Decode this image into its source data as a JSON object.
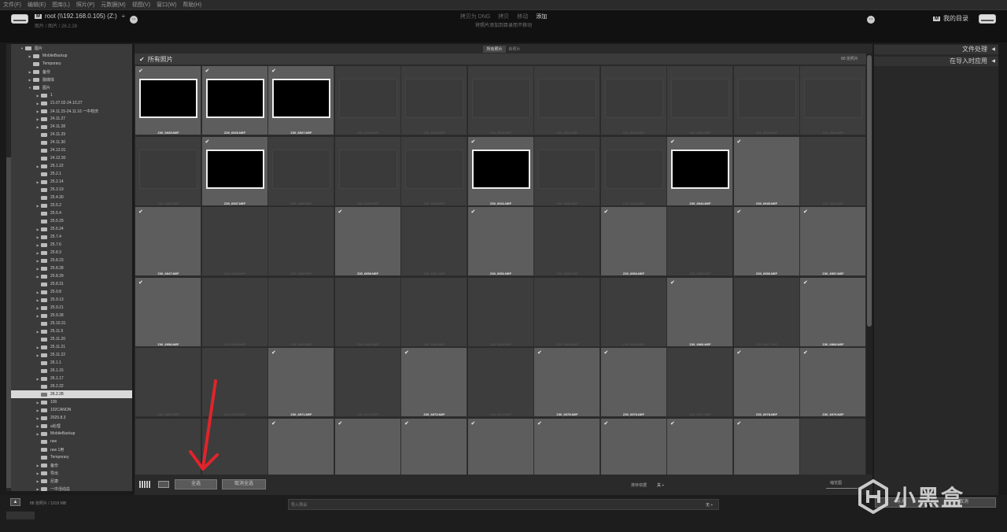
{
  "menu": [
    "文件(F)",
    "编辑(E)",
    "图库(L)",
    "照片(P)",
    "元数据(M)",
    "视图(V)",
    "窗口(W)",
    "帮助(H)"
  ],
  "header": {
    "source_badge": "M",
    "source_name": "root (\\\\192.168.0.105) (Z:)",
    "source_dropdown": "÷",
    "source_sub": "图片 / 图片 / 26.2.28",
    "left_nav": "⇔",
    "mode_tabs": [
      "拷贝为 DNG",
      "拷贝",
      "移动",
      "添加"
    ],
    "active_mode": "添加",
    "mode_desc": "将照片添加到目录而不移动",
    "right_nav": "⇔",
    "dest_badge": "M",
    "dest_name": "我的目录"
  },
  "view_tabs": [
    "所有照片",
    "新照片"
  ],
  "all_photos_label": "所有照片",
  "photo_count": "88 张照片",
  "folders": [
    {
      "label": "图片",
      "depth": 1,
      "tri": "▼"
    },
    {
      "label": "MobileBackup",
      "depth": 2,
      "tri": "▶"
    },
    {
      "label": "Temporary",
      "depth": 2,
      "tri": ""
    },
    {
      "label": "备份",
      "depth": 2,
      "tri": "▶"
    },
    {
      "label": "融媒体",
      "depth": 2,
      "tri": "▶"
    },
    {
      "label": "图片",
      "depth": 2,
      "tri": "▼"
    },
    {
      "label": "1",
      "depth": 3,
      "tri": "▶"
    },
    {
      "label": "21.07.02-24.10.27",
      "depth": 3,
      "tri": "▶"
    },
    {
      "label": "24.11.15-24.11.16 一中校庆",
      "depth": 3,
      "tri": "▶"
    },
    {
      "label": "24.11.27",
      "depth": 3,
      "tri": "▶"
    },
    {
      "label": "24.11.28",
      "depth": 3,
      "tri": "▶"
    },
    {
      "label": "24.11.29",
      "depth": 3,
      "tri": ""
    },
    {
      "label": "24.11.30",
      "depth": 3,
      "tri": ""
    },
    {
      "label": "24.12.01",
      "depth": 3,
      "tri": ""
    },
    {
      "label": "24.12.30",
      "depth": 3,
      "tri": ""
    },
    {
      "label": "25.1.22",
      "depth": 3,
      "tri": "▶"
    },
    {
      "label": "25.2.1",
      "depth": 3,
      "tri": ""
    },
    {
      "label": "25.2.14",
      "depth": 3,
      "tri": "▶"
    },
    {
      "label": "25.3.19",
      "depth": 3,
      "tri": ""
    },
    {
      "label": "25.4.30",
      "depth": 3,
      "tri": ""
    },
    {
      "label": "25.5.2",
      "depth": 3,
      "tri": "▶"
    },
    {
      "label": "25.5.4",
      "depth": 3,
      "tri": ""
    },
    {
      "label": "25.5.29",
      "depth": 3,
      "tri": ""
    },
    {
      "label": "25.6.24",
      "depth": 3,
      "tri": "▶"
    },
    {
      "label": "25.7.4",
      "depth": 3,
      "tri": "▶"
    },
    {
      "label": "25.7.6",
      "depth": 3,
      "tri": "▶"
    },
    {
      "label": "25.8.3",
      "depth": 3,
      "tri": "▶"
    },
    {
      "label": "25.8.23",
      "depth": 3,
      "tri": "▶"
    },
    {
      "label": "25.8.28",
      "depth": 3,
      "tri": "▶"
    },
    {
      "label": "25.8.29",
      "depth": 3,
      "tri": "▶"
    },
    {
      "label": "25.8.31",
      "depth": 3,
      "tri": ""
    },
    {
      "label": "25.9.8",
      "depth": 3,
      "tri": "▶"
    },
    {
      "label": "25.9.13",
      "depth": 3,
      "tri": "▶"
    },
    {
      "label": "25.9.21",
      "depth": 3,
      "tri": "▶"
    },
    {
      "label": "25.9.28",
      "depth": 3,
      "tri": "▶"
    },
    {
      "label": "25.10.31",
      "depth": 3,
      "tri": ""
    },
    {
      "label": "25.11.5",
      "depth": 3,
      "tri": "▶"
    },
    {
      "label": "25.11.20",
      "depth": 3,
      "tri": ""
    },
    {
      "label": "25.11.21",
      "depth": 3,
      "tri": "▶"
    },
    {
      "label": "25.11.22",
      "depth": 3,
      "tri": "▶"
    },
    {
      "label": "26.1.1",
      "depth": 3,
      "tri": ""
    },
    {
      "label": "26.1.15",
      "depth": 3,
      "tri": ""
    },
    {
      "label": "26.1.17",
      "depth": 3,
      "tri": "▶"
    },
    {
      "label": "26.2.22",
      "depth": 3,
      "tri": ""
    },
    {
      "label": "26.2.28",
      "depth": 3,
      "tri": "",
      "selected": true
    },
    {
      "label": "100",
      "depth": 3,
      "tri": "▶"
    },
    {
      "label": "102CANON",
      "depth": 3,
      "tri": "▶"
    },
    {
      "label": "2025.8.3",
      "depth": 3,
      "tri": "▶"
    },
    {
      "label": "a处理",
      "depth": 3,
      "tri": "▶"
    },
    {
      "label": "MobileBackup",
      "depth": 3,
      "tri": "▶"
    },
    {
      "label": "raw",
      "depth": 3,
      "tri": ""
    },
    {
      "label": "raw 1用",
      "depth": 3,
      "tri": ""
    },
    {
      "label": "Temporary",
      "depth": 3,
      "tri": ""
    },
    {
      "label": "备份",
      "depth": 3,
      "tri": "▶"
    },
    {
      "label": "导出",
      "depth": 3,
      "tri": "▶"
    },
    {
      "label": "尼康",
      "depth": 3,
      "tri": "▶"
    },
    {
      "label": "一中活动总",
      "depth": 3,
      "tri": "▶"
    }
  ],
  "grid": {
    "columns": 11,
    "cells": [
      {
        "name": "Z30_6925.NEF",
        "checked": true,
        "thumb": true
      },
      {
        "name": "Z30_6926.NEF",
        "checked": true,
        "thumb": true
      },
      {
        "name": "Z30_6927.NEF",
        "checked": true,
        "thumb": true
      },
      {
        "name": "Z30_6928.NEF",
        "checked": false,
        "thumb": true
      },
      {
        "name": "Z30_6929.NEF",
        "checked": false,
        "thumb": true
      },
      {
        "name": "Z30_6930.NEF",
        "checked": false,
        "thumb": true
      },
      {
        "name": "Z30_6931.NEF",
        "checked": false,
        "thumb": true
      },
      {
        "name": "Z30_6932.NEF",
        "checked": false,
        "thumb": true
      },
      {
        "name": "Z30_6933.NEF",
        "checked": false,
        "thumb": true
      },
      {
        "name": "Z30_6934.NEF",
        "checked": false,
        "thumb": true
      },
      {
        "name": "Z30_6935.NEF",
        "checked": false,
        "thumb": true
      },
      {
        "name": "Z30_6936.NEF",
        "checked": false,
        "thumb": true
      },
      {
        "name": "Z30_6937.NEF",
        "checked": true,
        "thumb": true
      },
      {
        "name": "Z30_6938.NEF",
        "checked": false,
        "thumb": true
      },
      {
        "name": "Z30_6939.NEF",
        "checked": false,
        "thumb": true
      },
      {
        "name": "Z30_6940.NEF",
        "checked": false,
        "thumb": true
      },
      {
        "name": "Z30_6941.NEF",
        "checked": true,
        "thumb": true
      },
      {
        "name": "Z30_6942.NEF",
        "checked": false,
        "thumb": true
      },
      {
        "name": "Z30_6943.NEF",
        "checked": false,
        "thumb": true
      },
      {
        "name": "Z30_6944.NEF",
        "checked": true,
        "thumb": true
      },
      {
        "name": "Z30_6945.NEF",
        "checked": true,
        "thumb": false
      },
      {
        "name": "Z30_6946.NEF",
        "checked": false,
        "thumb": false
      },
      {
        "name": "Z30_6947.NEF",
        "checked": true,
        "thumb": false
      },
      {
        "name": "Z30_6948.NEF",
        "checked": false,
        "thumb": false
      },
      {
        "name": "Z30_6949.NEF",
        "checked": false,
        "thumb": false
      },
      {
        "name": "Z30_6950.NEF",
        "checked": true,
        "thumb": false
      },
      {
        "name": "Z30_6951.NEF",
        "checked": false,
        "thumb": false
      },
      {
        "name": "Z30_6952.NEF",
        "checked": true,
        "thumb": false
      },
      {
        "name": "Z30_6953.NEF",
        "checked": false,
        "thumb": false
      },
      {
        "name": "Z30_6954.NEF",
        "checked": true,
        "thumb": false
      },
      {
        "name": "Z30_6955.NEF",
        "checked": false,
        "thumb": false
      },
      {
        "name": "Z30_6956.NEF",
        "checked": true,
        "thumb": false
      },
      {
        "name": "Z30_6957.NEF",
        "checked": true,
        "thumb": false
      },
      {
        "name": "Z30_6958.NEF",
        "checked": true,
        "thumb": false
      },
      {
        "name": "Z30_6959.NEF",
        "checked": false,
        "thumb": false
      },
      {
        "name": "Z30_6960.NEF",
        "checked": false,
        "thumb": false
      },
      {
        "name": "Z30_6961.NEF",
        "checked": false,
        "thumb": false
      },
      {
        "name": "Z30_6962.NEF",
        "checked": false,
        "thumb": false
      },
      {
        "name": "Z30_6963.NEF",
        "checked": false,
        "thumb": false
      },
      {
        "name": "Z30_6964.NEF",
        "checked": false,
        "thumb": false
      },
      {
        "name": "Z30_6965.NEF",
        "checked": false,
        "thumb": false
      },
      {
        "name": "Z30_6966.NEF",
        "checked": true,
        "thumb": false
      },
      {
        "name": "Z30_6967.NEF",
        "checked": false,
        "thumb": false
      },
      {
        "name": "Z30_6968.NEF",
        "checked": true,
        "thumb": false
      },
      {
        "name": "Z30_6969.NEF",
        "checked": false,
        "thumb": false
      },
      {
        "name": "Z30_6970.NEF",
        "checked": false,
        "thumb": false
      },
      {
        "name": "Z30_6971.NEF",
        "checked": true,
        "thumb": false
      },
      {
        "name": "Z30_6972.NEF",
        "checked": false,
        "thumb": false
      },
      {
        "name": "Z30_6973.NEF",
        "checked": true,
        "thumb": false
      },
      {
        "name": "Z30_6974.NEF",
        "checked": false,
        "thumb": false
      },
      {
        "name": "Z30_6975.NEF",
        "checked": true,
        "thumb": false
      },
      {
        "name": "Z30_6976.NEF",
        "checked": true,
        "thumb": false
      },
      {
        "name": "Z30_6977.NEF",
        "checked": false,
        "thumb": false
      },
      {
        "name": "Z30_6978.NEF",
        "checked": true,
        "thumb": false
      },
      {
        "name": "Z30_6979.NEF",
        "checked": true,
        "thumb": false
      },
      {
        "name": "",
        "checked": false,
        "thumb": false
      },
      {
        "name": "",
        "checked": false,
        "thumb": false
      },
      {
        "name": "",
        "checked": true,
        "thumb": false
      },
      {
        "name": "",
        "checked": true,
        "thumb": false
      },
      {
        "name": "",
        "checked": true,
        "thumb": false
      },
      {
        "name": "",
        "checked": true,
        "thumb": false
      },
      {
        "name": "",
        "checked": true,
        "thumb": false
      },
      {
        "name": "",
        "checked": true,
        "thumb": false
      },
      {
        "name": "",
        "checked": true,
        "thumb": false
      },
      {
        "name": "",
        "checked": true,
        "thumb": false
      },
      {
        "name": "",
        "checked": false,
        "thumb": false
      }
    ]
  },
  "toolbar": {
    "select_all": "全选",
    "deselect_all": "取消全选",
    "sort_label": "排序依据",
    "sort_value": "关 ÷",
    "thumb_label": "缩览图"
  },
  "right_panel": {
    "file_handling": "文件处理",
    "apply_during_import": "在导入时应用",
    "arrow": "◀"
  },
  "bottom": {
    "collapse": "▲",
    "status": "88 张照片 / 1019 MB",
    "preset_label": "导入预设:",
    "preset_value": "无 ÷",
    "import_button": "导入",
    "cancel_button": "取消"
  },
  "watermark": {
    "text": "小黑盒"
  },
  "colors": {
    "annotation_arrow": "#e0242b",
    "selected_folder": "#d9d9d9"
  }
}
